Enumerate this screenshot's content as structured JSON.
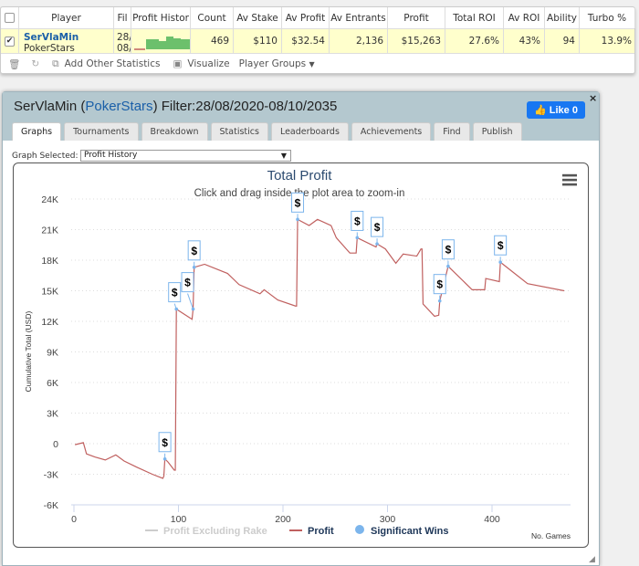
{
  "table": {
    "headers": [
      "Player",
      "Fil",
      "Profit Histor",
      "Count",
      "Av Stake",
      "Av Profit",
      "Av Entrants",
      "Profit",
      "Total ROI",
      "Av ROI",
      "Ability",
      "Turbo %"
    ],
    "row": {
      "checked": true,
      "player": "SerVlaMin",
      "site": "PokerStars",
      "filter_line1": "28/",
      "filter_line2": "08/",
      "count": "469",
      "av_stake": "$110",
      "av_profit": "$32.54",
      "av_entrants": "2,136",
      "profit": "$15,263",
      "total_roi": "27.6%",
      "av_roi": "43%",
      "ability": "94",
      "turbo": "13.9%"
    },
    "toolbar": {
      "add_stats": "Add Other Statistics",
      "visualize": "Visualize",
      "player_groups": "Player Groups"
    }
  },
  "dialog": {
    "title_player": "SerVlaMin (",
    "title_site": "PokerStars",
    "title_rest": ") Filter:28/08/2020-08/10/2035",
    "like_label": "Like 0",
    "close": "×",
    "tabs": [
      "Graphs",
      "Tournaments",
      "Breakdown",
      "Statistics",
      "Leaderboards",
      "Achievements",
      "Find",
      "Publish"
    ],
    "active_tab": "Graphs",
    "graph_selected_label": "Graph Selected:",
    "graph_selected_value": "Profit History"
  },
  "chart_data": {
    "type": "line",
    "title": "Total Profit",
    "subtitle": "Click and drag inside the plot area to zoom-in",
    "xlabel": "No. Games",
    "ylabel": "Cumulative Total (USD)",
    "xlim": [
      0,
      475
    ],
    "ylim": [
      -6000,
      24000
    ],
    "xticks": [
      "0",
      "100",
      "200",
      "300",
      "400"
    ],
    "yticks": [
      "-6K",
      "-3K",
      "0",
      "3K",
      "6K",
      "9K",
      "12K",
      "15K",
      "18K",
      "21K",
      "24K"
    ],
    "grid": true,
    "legend": [
      "Profit Excluding Rake",
      "Profit",
      "Significant Wins"
    ],
    "legend_placement": "bottom",
    "colors": {
      "profit": "#c0605f",
      "excluding_rake": "#cccccc",
      "wins": "#7cb5ec"
    },
    "series": [
      {
        "name": "Profit",
        "x": [
          1,
          9,
          12,
          20,
          30,
          40,
          48,
          60,
          75,
          85,
          86,
          87,
          90,
          96,
          97,
          98,
          113,
          114,
          115,
          125,
          147,
          158,
          178,
          182,
          195,
          212,
          213,
          214,
          225,
          233,
          246,
          251,
          264,
          269,
          270,
          271,
          289,
          290,
          298,
          308,
          315,
          328,
          332,
          333,
          334,
          345,
          349,
          350,
          358,
          381,
          393,
          394,
          407,
          408,
          434,
          469
        ],
        "y": [
          -100,
          100,
          -1000,
          -1300,
          -1600,
          -1100,
          -1700,
          -2300,
          -3000,
          -3400,
          -3200,
          -1500,
          -1800,
          -2600,
          -2600,
          13200,
          12200,
          13200,
          17300,
          17600,
          16700,
          15600,
          14700,
          15100,
          14100,
          13500,
          13500,
          22000,
          21400,
          22000,
          21400,
          20200,
          18700,
          18700,
          18700,
          20200,
          19300,
          19600,
          19100,
          17700,
          18600,
          18400,
          19100,
          19100,
          13700,
          12500,
          12600,
          14000,
          17400,
          15100,
          15100,
          16200,
          15900,
          17800,
          15700,
          15000
        ]
      },
      {
        "name": "Significant Wins",
        "x": [
          87,
          98,
          114,
          115,
          214,
          271,
          290,
          350,
          358,
          408
        ],
        "y": [
          -1500,
          13200,
          13200,
          17300,
          22000,
          20200,
          19600,
          14000,
          17400,
          17800
        ],
        "label": "$"
      }
    ]
  }
}
